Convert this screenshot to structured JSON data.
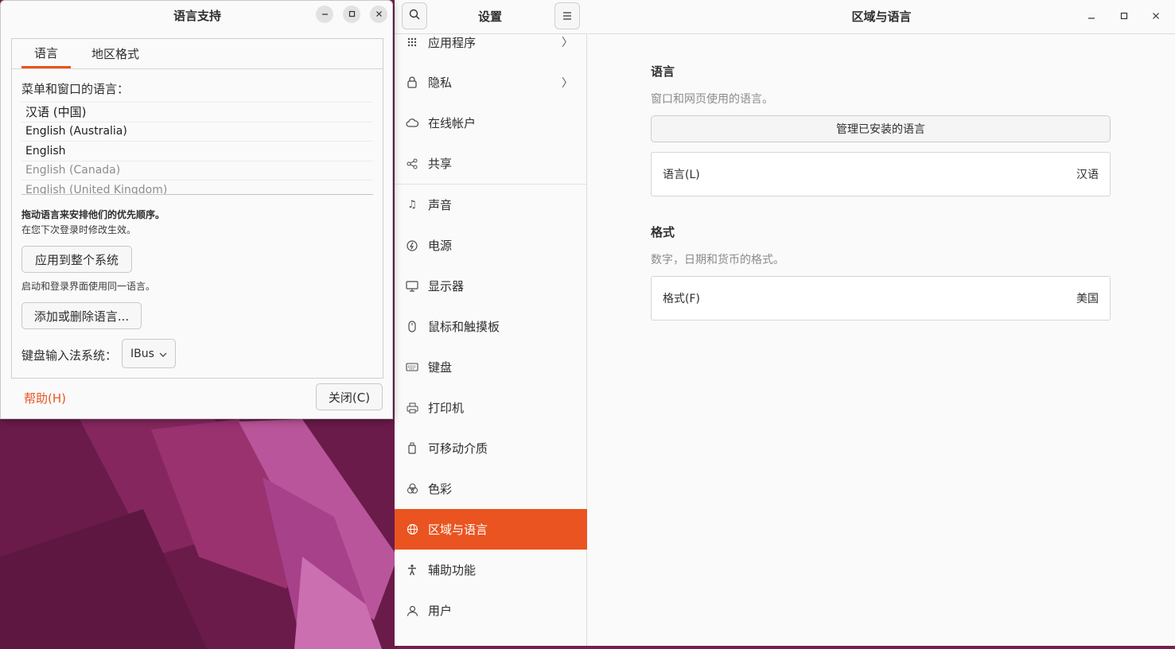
{
  "dialog": {
    "title": "语言支持",
    "tabs": [
      {
        "label": "语言"
      },
      {
        "label": "地区格式"
      }
    ],
    "menu_language_label": "菜单和窗口的语言：",
    "languages": [
      {
        "label": "汉语 (中国)"
      },
      {
        "label": "English (Australia)"
      },
      {
        "label": "English"
      },
      {
        "label": "English (Canada)"
      },
      {
        "label": "English (United Kingdom)"
      }
    ],
    "drag_hint": "拖动语言来安排他们的优先顺序。",
    "effect_hint": "在您下次登录时修改生效。",
    "apply_button": "应用到整个系统",
    "login_hint": "启动和登录界面使用同一语言。",
    "add_remove_button": "添加或删除语言...",
    "im_label": "键盘输入法系统：",
    "im_value": "IBus",
    "help": "帮助(H)",
    "close": "关闭(C)"
  },
  "settings": {
    "sidebar_title": "设置",
    "nav": [
      {
        "label": "应用程序",
        "icon": "apps-grid-icon"
      },
      {
        "label": "隐私",
        "icon": "lock-icon"
      },
      {
        "label": "在线帐户",
        "icon": "cloud-icon"
      },
      {
        "label": "共享",
        "icon": "share-icon"
      },
      {
        "label": "声音",
        "icon": "music-note-icon"
      },
      {
        "label": "电源",
        "icon": "power-icon"
      },
      {
        "label": "显示器",
        "icon": "monitor-icon"
      },
      {
        "label": "鼠标和触摸板",
        "icon": "mouse-icon"
      },
      {
        "label": "键盘",
        "icon": "keyboard-icon"
      },
      {
        "label": "打印机",
        "icon": "printer-icon"
      },
      {
        "label": "可移动介质",
        "icon": "removable-media-icon"
      },
      {
        "label": "色彩",
        "icon": "color-icon"
      },
      {
        "label": "区域与语言",
        "icon": "globe-icon"
      },
      {
        "label": "辅助功能",
        "icon": "accessibility-icon"
      },
      {
        "label": "用户",
        "icon": "user-icon"
      }
    ],
    "content_title": "区域与语言",
    "language_section": {
      "title": "语言",
      "desc": "窗口和网页使用的语言。",
      "manage_button": "管理已安装的语言",
      "row_label": "语言(L)",
      "row_value": "汉语"
    },
    "format_section": {
      "title": "格式",
      "desc": "数字，日期和货币的格式。",
      "row_label": "格式(F)",
      "row_value": "美国"
    }
  },
  "colors": {
    "accent": "#e95420",
    "wallpaper": "#6d1d4e"
  }
}
